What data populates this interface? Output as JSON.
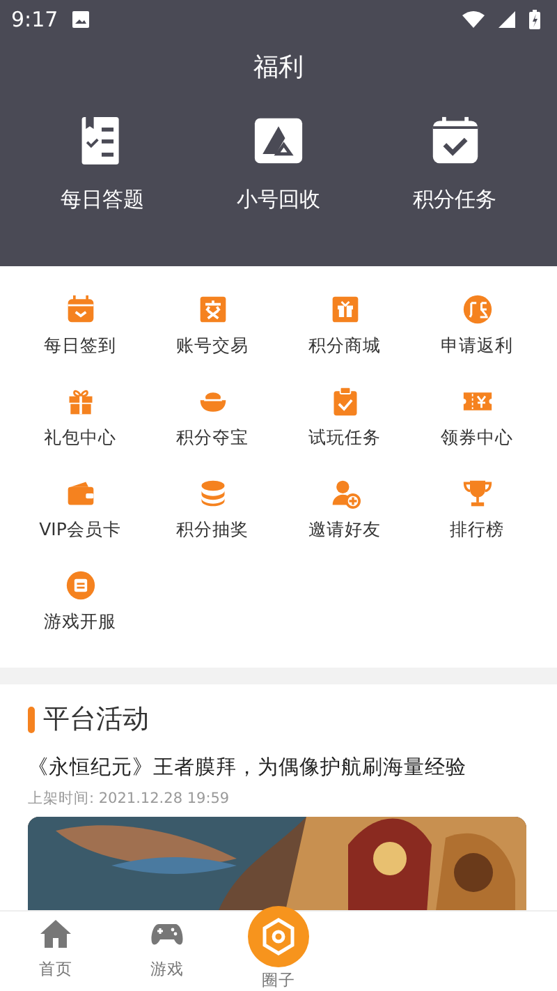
{
  "status_bar": {
    "time": "9:17"
  },
  "header": {
    "title": "福利",
    "features": [
      {
        "label": "每日答题"
      },
      {
        "label": "小号回收"
      },
      {
        "label": "积分任务"
      }
    ]
  },
  "services": [
    {
      "label": "每日签到"
    },
    {
      "label": "账号交易"
    },
    {
      "label": "积分商城"
    },
    {
      "label": "申请返利"
    },
    {
      "label": "礼包中心"
    },
    {
      "label": "积分夺宝"
    },
    {
      "label": "试玩任务"
    },
    {
      "label": "领券中心"
    },
    {
      "label": "VIP会员卡"
    },
    {
      "label": "积分抽奖"
    },
    {
      "label": "邀请好友"
    },
    {
      "label": "排行榜"
    },
    {
      "label": "游戏开服"
    }
  ],
  "activities": {
    "title": "平台活动",
    "items": [
      {
        "headline": "《永恒纪元》王者膜拜，为偶像护航刷海量经验",
        "date": "上架时间: 2021.12.28 19:59"
      }
    ]
  },
  "bottom_nav": [
    {
      "label": "首页",
      "kind": "normal"
    },
    {
      "label": "游戏",
      "kind": "normal"
    },
    {
      "label": "圈子",
      "kind": "center"
    }
  ]
}
